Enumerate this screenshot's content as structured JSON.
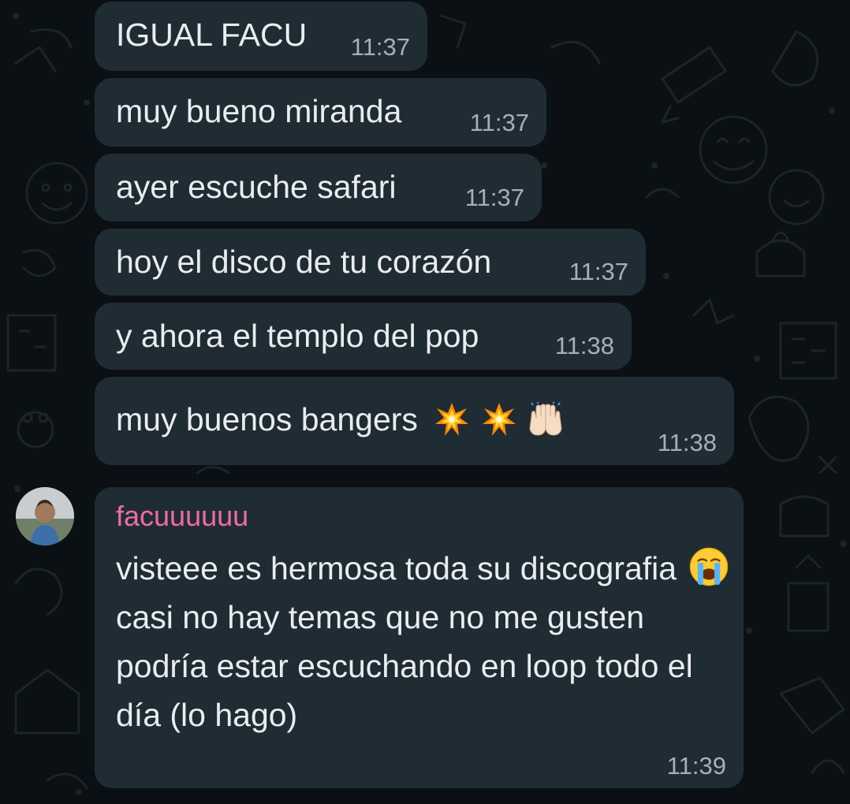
{
  "messages": [
    {
      "text": "IGUAL FACU",
      "time": "11:37"
    },
    {
      "text": "muy bueno miranda",
      "time": "11:37"
    },
    {
      "text": "ayer escuche safari",
      "time": "11:37"
    },
    {
      "text": "hoy el disco de tu corazón",
      "time": "11:37"
    },
    {
      "text": "y ahora el templo del pop",
      "time": "11:38"
    },
    {
      "text": "muy buenos bangers",
      "emojis": [
        "collision-emoji",
        "collision-emoji",
        "raising-hands-emoji"
      ],
      "time": "11:38"
    }
  ],
  "reply": {
    "sender": "facuuuuuu",
    "sender_color": "#f06aa8",
    "text_before_emoji": "visteee es hermosa toda su discografia",
    "emoji": "loudly-crying-face-emoji",
    "text_after_emoji": "casi no hay temas que no me gusten podría estar escuchando en loop todo el día (lo hago)",
    "time": "11:39"
  },
  "colors": {
    "background": "#0b1014",
    "bubble": "#1f2c34",
    "text": "#e9edef",
    "time": "#a6b0b6"
  }
}
